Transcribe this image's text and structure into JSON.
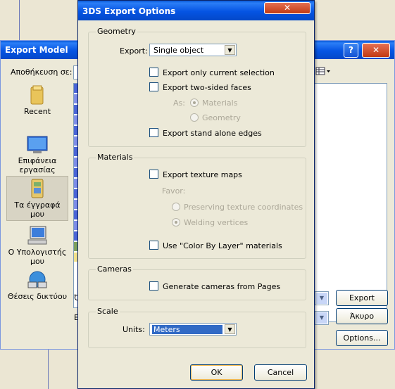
{
  "export_model": {
    "title": "Export Model",
    "save_in_label": "Αποθήκευση σε:",
    "places": [
      {
        "label": "Recent"
      },
      {
        "label": "Επιφάνεια εργασίας"
      },
      {
        "label": "Τα έγγραφά μου"
      },
      {
        "label": "Ο Υπολογιστής μου"
      },
      {
        "label": "Θέσεις δικτύου"
      }
    ],
    "help_glyph": "?",
    "close_glyph": "✕",
    "export_button": "Export",
    "cancel_button": "Άκυρο",
    "options_button": "Options...",
    "partial_label_1": "Ό",
    "partial_label_2": "Ε"
  },
  "options_dialog": {
    "title": "3DS Export Options",
    "close_glyph": "✕",
    "geometry": {
      "group_title": "Geometry",
      "export_label": "Export:",
      "export_value": "Single object",
      "export_current_selection": "Export only current selection",
      "export_two_sided": "Export two-sided faces",
      "as_label": "As:",
      "as_materials": "Materials",
      "as_geometry": "Geometry",
      "export_stand_alone_edges": "Export stand alone edges"
    },
    "materials": {
      "group_title": "Materials",
      "export_texture_maps": "Export texture maps",
      "favor_label": "Favor:",
      "preserving_texture": "Preserving texture coordinates",
      "welding_vertices": "Welding vertices",
      "color_by_layer": "Use \"Color By Layer\" materials"
    },
    "cameras": {
      "group_title": "Cameras",
      "generate_cameras": "Generate cameras from Pages"
    },
    "scale": {
      "group_title": "Scale",
      "units_label": "Units:",
      "units_value": "Meters"
    },
    "ok_button": "OK",
    "cancel_button": "Cancel"
  }
}
